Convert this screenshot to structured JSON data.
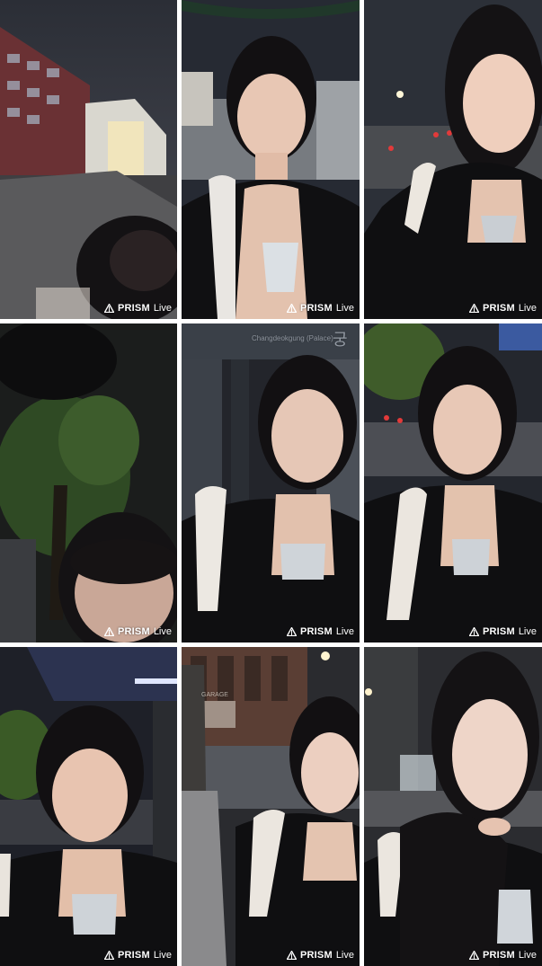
{
  "watermark": {
    "brand": "PRISM",
    "suffix": "Live",
    "icon": "prism-triangle-icon",
    "color": "#ffffff"
  },
  "tiles": [
    {
      "scene": "night-street-blurred-building"
    },
    {
      "scene": "woman-night-street-umbrella"
    },
    {
      "scene": "woman-night-road-traffic-lights"
    },
    {
      "scene": "dark-tree-face-low-angle"
    },
    {
      "scene": "woman-palace-sign-backdrop",
      "sign_text": "Changdeokgung (Palace)",
      "sign_korean": "궁"
    },
    {
      "scene": "woman-night-street-trees"
    },
    {
      "scene": "woman-bus-stop-night"
    },
    {
      "scene": "woman-street-building-garage",
      "sign_text": "GARAGE"
    },
    {
      "scene": "woman-holding-sleeve-night"
    }
  ]
}
